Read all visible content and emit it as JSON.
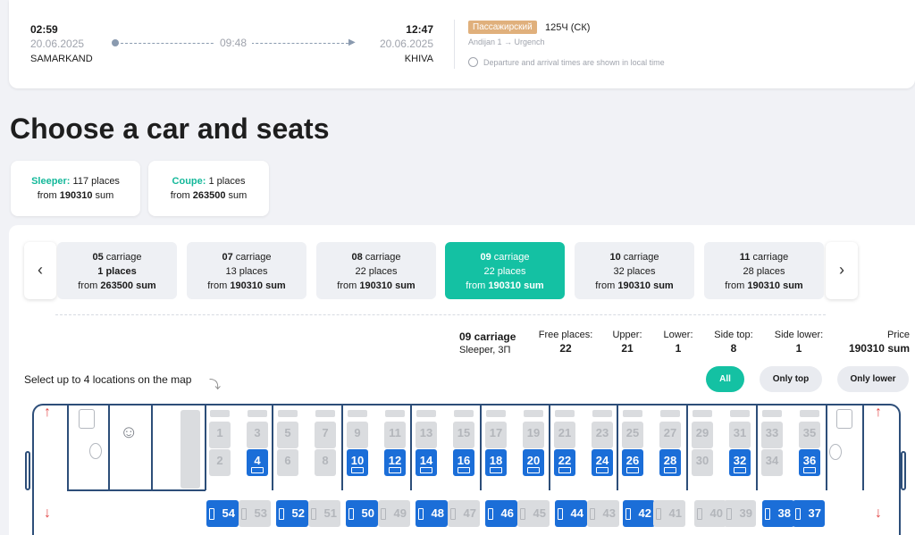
{
  "trip": {
    "dep_time": "02:59",
    "dep_date": "20.06.2025",
    "dep_city": "SAMARKAND",
    "arr_time": "12:47",
    "arr_date": "20.06.2025",
    "arr_city": "KHIVA",
    "duration": "09:48",
    "train_type": "Пассажирский",
    "train_number": "125Ч (СК)",
    "train_route": "Andijan 1 → Urgench",
    "tz_note": "Departure and arrival times are shown in local time"
  },
  "page_title": "Choose a car and seats",
  "classes": [
    {
      "name": "Sleeper:",
      "places": "117 places",
      "from": "from",
      "price": "190310",
      "unit": "sum"
    },
    {
      "name": "Coupe:",
      "places": "1 places",
      "from": "from",
      "price": "263500",
      "unit": "sum"
    }
  ],
  "carriages": [
    {
      "num": "05",
      "word": "carriage",
      "places": "1 places",
      "from": "from",
      "price": "263500 sum"
    },
    {
      "num": "07",
      "word": "carriage",
      "places": "13 places",
      "from": "from",
      "price": "190310 sum"
    },
    {
      "num": "08",
      "word": "carriage",
      "places": "22 places",
      "from": "from",
      "price": "190310 sum"
    },
    {
      "num": "09",
      "word": "carriage",
      "places": "22 places",
      "from": "from",
      "price": "190310 sum"
    },
    {
      "num": "10",
      "word": "carriage",
      "places": "32 places",
      "from": "from",
      "price": "190310 sum"
    },
    {
      "num": "11",
      "word": "carriage",
      "places": "28 places",
      "from": "from",
      "price": "190310 sum"
    }
  ],
  "selected": {
    "title": "09 carriage",
    "subtitle": "Sleeper, 3П",
    "free_lbl": "Free places:",
    "free": "22",
    "upper_lbl": "Upper:",
    "upper": "21",
    "lower_lbl": "Lower:",
    "lower": "1",
    "sidetop_lbl": "Side top:",
    "sidetop": "8",
    "sidelower_lbl": "Side lower:",
    "sidelower": "1",
    "price_lbl": "Price",
    "price": "190310 sum"
  },
  "hint": "Select up to 4 locations on the map",
  "filters": {
    "all": "All",
    "top": "Only top",
    "lower": "Only lower"
  },
  "colors": {
    "accent": "#14c1a3",
    "seat_free": "#1b6ed8",
    "seat_busy": "#dadcdf",
    "badge": "#e0b07c",
    "map_line": "#2d4e79",
    "arrow": "#e34a4a"
  },
  "seats_top": [
    {
      "n": "1",
      "free": false
    },
    {
      "n": "3",
      "free": false
    },
    {
      "n": "5",
      "free": false
    },
    {
      "n": "7",
      "free": false
    },
    {
      "n": "9",
      "free": false
    },
    {
      "n": "11",
      "free": false
    },
    {
      "n": "13",
      "free": false
    },
    {
      "n": "15",
      "free": false
    },
    {
      "n": "17",
      "free": false
    },
    {
      "n": "19",
      "free": false
    },
    {
      "n": "21",
      "free": false
    },
    {
      "n": "23",
      "free": false
    },
    {
      "n": "25",
      "free": false
    },
    {
      "n": "27",
      "free": false
    },
    {
      "n": "29",
      "free": false
    },
    {
      "n": "31",
      "free": false
    },
    {
      "n": "33",
      "free": false
    },
    {
      "n": "35",
      "free": false
    }
  ],
  "seats_bottom": [
    {
      "n": "2",
      "free": false
    },
    {
      "n": "4",
      "free": true
    },
    {
      "n": "6",
      "free": false
    },
    {
      "n": "8",
      "free": false
    },
    {
      "n": "10",
      "free": true
    },
    {
      "n": "12",
      "free": true
    },
    {
      "n": "14",
      "free": true
    },
    {
      "n": "16",
      "free": true
    },
    {
      "n": "18",
      "free": true
    },
    {
      "n": "20",
      "free": true
    },
    {
      "n": "22",
      "free": true
    },
    {
      "n": "24",
      "free": true
    },
    {
      "n": "26",
      "free": true
    },
    {
      "n": "28",
      "free": true
    },
    {
      "n": "30",
      "free": false
    },
    {
      "n": "32",
      "free": true
    },
    {
      "n": "34",
      "free": false
    },
    {
      "n": "36",
      "free": true
    }
  ],
  "seats_side": [
    {
      "n": "54",
      "free": true
    },
    {
      "n": "53",
      "free": false
    },
    {
      "n": "52",
      "free": true
    },
    {
      "n": "51",
      "free": false
    },
    {
      "n": "50",
      "free": true
    },
    {
      "n": "49",
      "free": false
    },
    {
      "n": "48",
      "free": true
    },
    {
      "n": "47",
      "free": false
    },
    {
      "n": "46",
      "free": true
    },
    {
      "n": "45",
      "free": false
    },
    {
      "n": "44",
      "free": true
    },
    {
      "n": "43",
      "free": false
    },
    {
      "n": "42",
      "free": true
    },
    {
      "n": "41",
      "free": false
    },
    {
      "n": "40",
      "free": false
    },
    {
      "n": "39",
      "free": false
    },
    {
      "n": "38",
      "free": true
    },
    {
      "n": "37",
      "free": true
    }
  ],
  "icons": {
    "clock": "clock-icon",
    "prev": "chevron-left-icon",
    "next": "chevron-right-icon",
    "toilet": "toilet-icon",
    "conductor": "conductor-icon",
    "exit": "exit-arrow-icon"
  }
}
